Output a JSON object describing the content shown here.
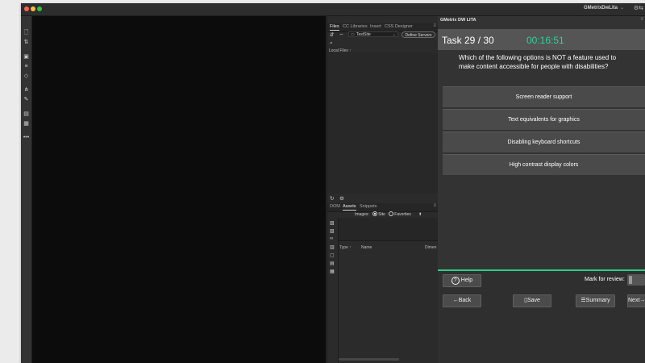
{
  "window": {
    "workspace": "GMetrixDwLita",
    "workspace_caret": "⌄",
    "title_icon": "⚙︎⇆"
  },
  "toolbar": {
    "icons": [
      "file-icon",
      "arrows-icon",
      "inspect-icon",
      "align-icon",
      "target-icon",
      "link-icon",
      "pen-icon",
      "comment-icon",
      "calendar-icon",
      "more-icon"
    ]
  },
  "files_panel": {
    "tabs": [
      "Files",
      "CC Libraries",
      "Insert",
      "CSS Designer"
    ],
    "site_select": "TestSite",
    "define_servers": "Define Servers",
    "local_files": "Local Files ↑"
  },
  "assets_panel": {
    "tabs": [
      "DOM",
      "Assets",
      "Snippets"
    ],
    "images_label": "Images:",
    "site_option": "Site",
    "favorites_option": "Favorites",
    "columns": [
      "Type ↑",
      "Name",
      "Dimen"
    ]
  },
  "quiz": {
    "panel_title": "GMetrix DW LITA",
    "task": "Task 29 / 30",
    "timer": "00:16:51",
    "question": "Which of the following options is NOT a feature used to make content accessible for people with disabilities?",
    "options": [
      "Screen reader support",
      "Text equivalents for graphics",
      "Disabling keyboard shortcuts",
      "High contrast display colors"
    ],
    "help": "Help",
    "mark_for_review": "Mark for review:",
    "mark_for_review_checked": false,
    "back": "Back",
    "save": "Save",
    "summary": "Summary",
    "next": "Next",
    "accent_color": "#2dd39a"
  }
}
